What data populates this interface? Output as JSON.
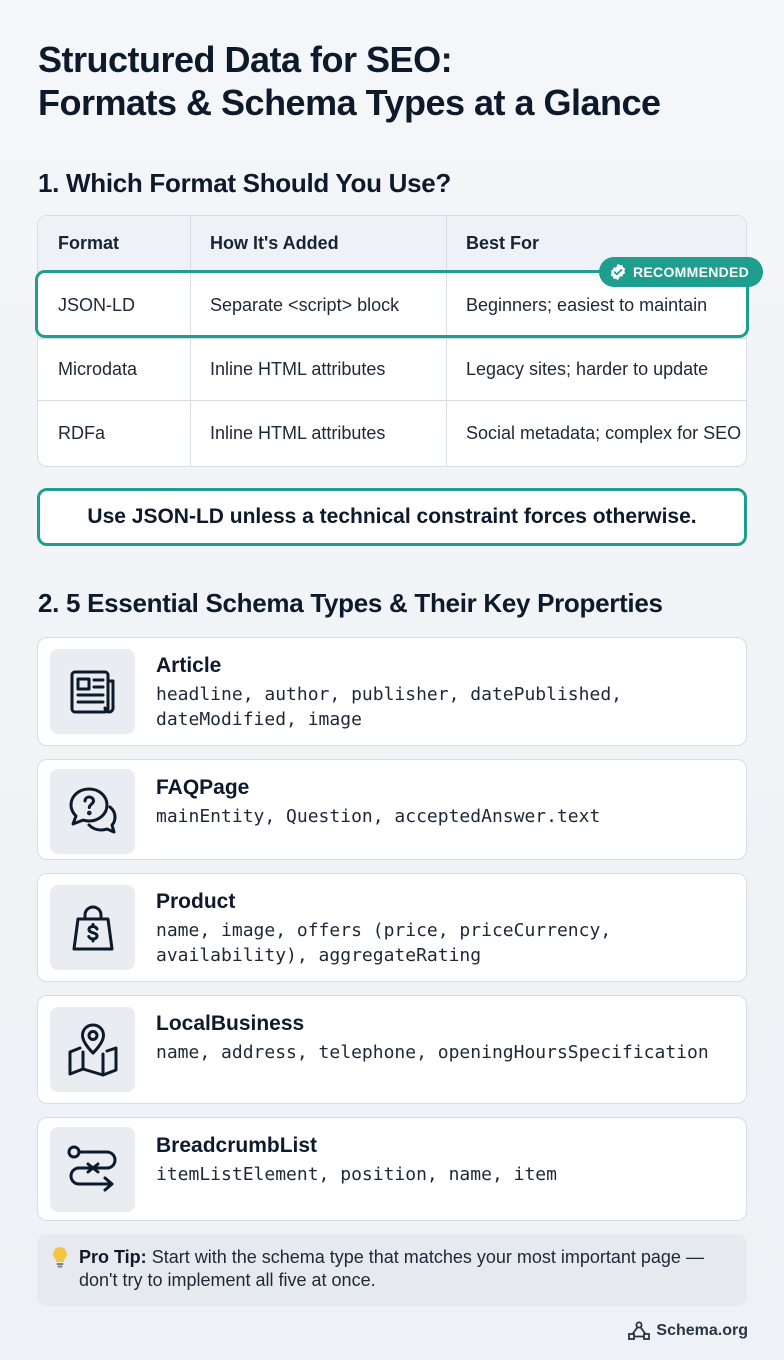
{
  "title": {
    "line1": "Structured Data for SEO:",
    "line2": "Formats & Schema Types at a Glance"
  },
  "section1": {
    "heading": "1. Which Format Should You Use?",
    "table": {
      "headers": [
        "Format",
        "How It's Added",
        "Best For"
      ],
      "rows": [
        [
          "JSON-LD",
          "Separate <script> block",
          "Beginners; easiest to maintain"
        ],
        [
          "Microdata",
          "Inline HTML attributes",
          "Legacy sites; harder to update"
        ],
        [
          "RDFa",
          "Inline HTML attributes",
          "Social metadata; complex for SEO"
        ]
      ]
    },
    "badge": "RECOMMENDED",
    "callout": "Use JSON-LD unless a technical constraint forces otherwise."
  },
  "section2": {
    "heading": "2. 5 Essential Schema Types & Their Key Properties",
    "cards": [
      {
        "name": "Article",
        "props": "headline, author, publisher, datePublished, dateModified, image",
        "icon": "newspaper-icon"
      },
      {
        "name": "FAQPage",
        "props": "mainEntity, Question, acceptedAnswer.text",
        "icon": "question-chat-icon"
      },
      {
        "name": "Product",
        "props": "name, image, offers (price, priceCurrency, availability), aggregateRating",
        "icon": "shopping-bag-icon"
      },
      {
        "name": "LocalBusiness",
        "props": "name, address, telephone, openingHoursSpecification",
        "icon": "map-pin-icon"
      },
      {
        "name": "BreadcrumbList",
        "props": "itemListElement, position, name, item",
        "icon": "route-icon"
      }
    ]
  },
  "tip": {
    "label": "Pro Tip:",
    "text": "Start with the schema type that matches your most important page — don't try to implement all five at once."
  },
  "footer": {
    "brand": "Schema.org"
  },
  "colors": {
    "accent": "#1f9e8f",
    "text": "#0d1a2b",
    "card_bg": "#ffffff",
    "icon_bg": "#e9ecf1"
  }
}
